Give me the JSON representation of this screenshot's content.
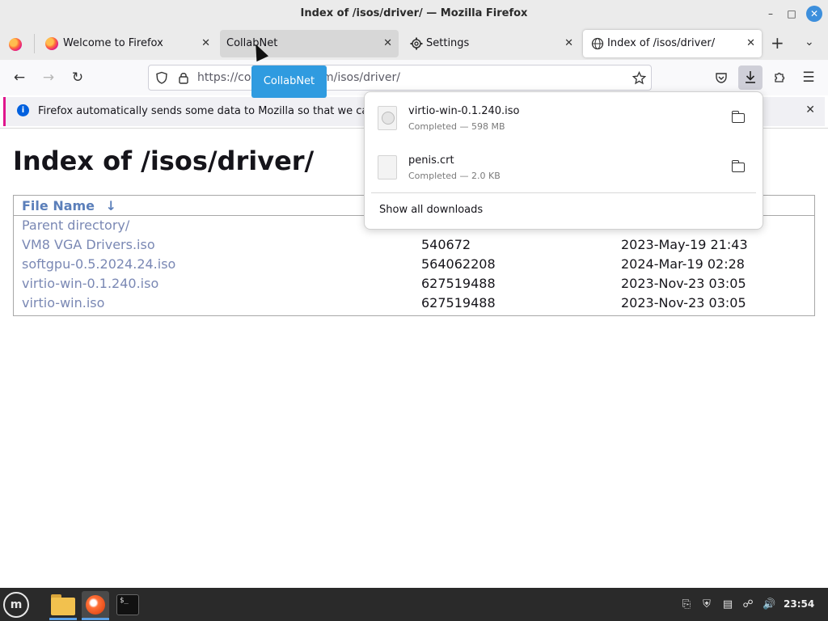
{
  "window": {
    "title": "Index of /isos/driver/ — Mozilla Firefox"
  },
  "tabs": [
    {
      "label": "Welcome to Firefox"
    },
    {
      "label": "CollabNet"
    },
    {
      "label": "Settings"
    },
    {
      "label": "Index of /isos/driver/"
    }
  ],
  "urlbar": {
    "url": "https://collabnet.com/isos/driver/",
    "visible_start": "https://co",
    "visible_end": "m/isos/driver/"
  },
  "tooltip": {
    "text": "CollabNet"
  },
  "notification": {
    "text": "Firefox automatically sends some data to Mozilla so that we can imp"
  },
  "page": {
    "title": "Index of /isos/driver/",
    "column_header": "File Name",
    "sort_indicator": "↓",
    "parent": "Parent directory/",
    "rows": [
      {
        "name": "VM8 VGA Drivers.iso",
        "size": "540672",
        "date": "2023-May-19 21:43"
      },
      {
        "name": "softgpu-0.5.2024.24.iso",
        "size": "564062208",
        "date": "2024-Mar-19 02:28"
      },
      {
        "name": "virtio-win-0.1.240.iso",
        "size": "627519488",
        "date": "2023-Nov-23 03:05"
      },
      {
        "name": "virtio-win.iso",
        "size": "627519488",
        "date": "2023-Nov-23 03:05"
      }
    ]
  },
  "downloads": {
    "items": [
      {
        "name": "virtio-win-0.1.240.iso",
        "status": "Completed — 598 MB"
      },
      {
        "name": "penis.crt",
        "status": "Completed — 2.0 KB"
      }
    ],
    "show_all": "Show all downloads"
  },
  "taskbar": {
    "clock": "23:54"
  },
  "colors": {
    "accent": "#0060df",
    "tooltip": "#2f9be0",
    "link": "#7a88b4",
    "notification_border": "#e0168d"
  },
  "icons": [
    "firefox-icon",
    "gear-icon",
    "close-icon",
    "back-icon",
    "forward-icon",
    "reload-icon",
    "shield-icon",
    "lock-icon",
    "star-icon",
    "pocket-icon",
    "download-icon",
    "extensions-icon",
    "menu-icon",
    "info-icon",
    "folder-icon",
    "file-icon",
    "mint-menu-icon",
    "terminal-icon",
    "volume-icon",
    "network-icon",
    "clipboard-icon",
    "shield-tray-icon"
  ]
}
